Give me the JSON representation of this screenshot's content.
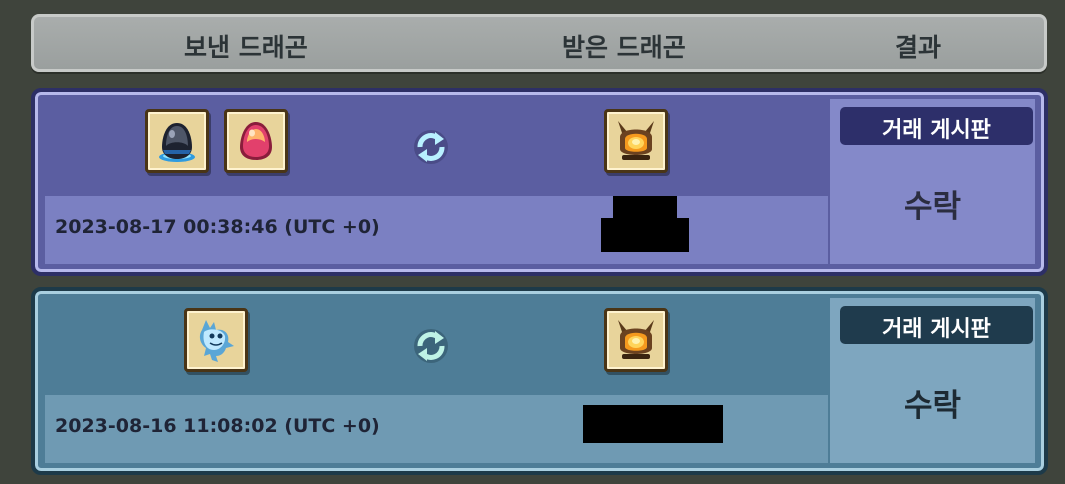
{
  "header": {
    "sent_label": "보낸 드래곤",
    "received_label": "받은 드래곤",
    "result_label": "결과"
  },
  "trades": [
    {
      "sent_items": [
        "dark-egg-icon",
        "pink-egg-icon"
      ],
      "received_items": [
        "fire-helmet-icon"
      ],
      "timestamp": "2023-08-17 00:38:46 (UTC +0)",
      "source": "거래 게시판",
      "status": "수락"
    },
    {
      "sent_items": [
        "ice-dragon-icon"
      ],
      "received_items": [
        "fire-helmet-icon"
      ],
      "timestamp": "2023-08-16 11:08:02 (UTC +0)",
      "source": "거래 게시판",
      "status": "수락"
    }
  ],
  "colors": {
    "background": "#3f443c",
    "card1": "#5b5ea1",
    "card2": "#4e7d97"
  }
}
